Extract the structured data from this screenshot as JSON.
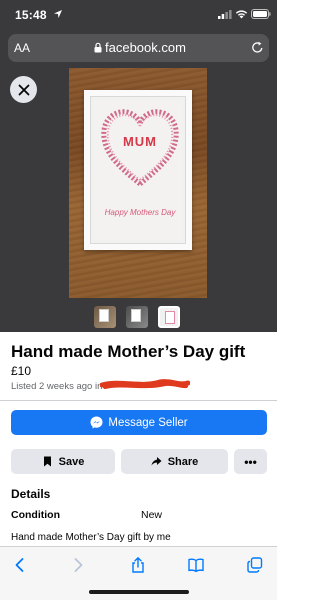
{
  "status_bar": {
    "time": "15:48"
  },
  "browser": {
    "text_size_label": "AA",
    "url": "facebook.com"
  },
  "listing": {
    "title": "Hand made Mother’s Day gift",
    "price": "£10",
    "listed": "Listed 2 weeks ago in",
    "photo": {
      "heart_text": "MUM",
      "caption_text": "Happy Mothers Day"
    },
    "thumbnail_count": 3,
    "selected_thumbnail_index": 2
  },
  "actions": {
    "message_label": "Message Seller",
    "save_label": "Save",
    "share_label": "Share",
    "more_label": "•••"
  },
  "details": {
    "heading": "Details",
    "condition_label": "Condition",
    "condition_value": "New",
    "description": "Hand made Mother’s Day gift by me"
  },
  "colors": {
    "facebook_blue": "#1877f2",
    "chrome_dark": "#3a3a3c",
    "button_grey": "#e4e6eb",
    "redaction_red": "#e03a1e",
    "safari_blue": "#007aff"
  },
  "icons": [
    "location-arrow-icon",
    "signal-icon",
    "wifi-icon",
    "battery-icon",
    "lock-icon",
    "reload-icon",
    "close-icon",
    "messenger-icon",
    "bookmark-icon",
    "share-arrow-icon",
    "back-icon",
    "forward-icon",
    "share-icon",
    "bookmarks-icon",
    "tabs-icon"
  ]
}
